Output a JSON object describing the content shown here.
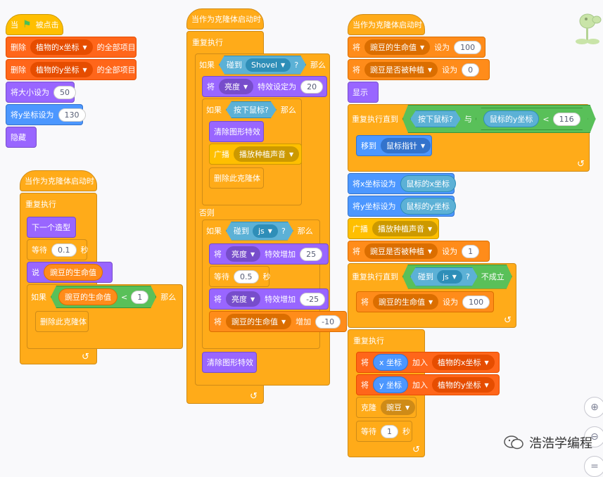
{
  "script1": {
    "hat_when": "当",
    "hat_clicked": "被点击",
    "del1_label": "删除",
    "del1_list": "植物的x坐标",
    "del1_suffix": "的全部项目",
    "del2_label": "删除",
    "del2_list": "植物的y坐标",
    "del2_suffix": "的全部项目",
    "size_label": "将大小设为",
    "size_value": "50",
    "sety_label": "将y坐标设为",
    "sety_value": "130",
    "hide_label": "隐藏"
  },
  "script2": {
    "hat": "当作为克隆体启动时",
    "forever": "重复执行",
    "next_costume": "下一个造型",
    "wait_label": "等待",
    "wait_value": "0.1",
    "wait_unit": "秒",
    "say_label": "说",
    "say_var": "豌豆的生命值",
    "if_label": "如果",
    "if_var": "豌豆的生命值",
    "if_op": "<",
    "if_value": "1",
    "if_then": "那么",
    "delete_clone": "删除此克隆体"
  },
  "script3": {
    "hat": "当作为克隆体启动时",
    "forever": "重复执行",
    "if_label": "如果",
    "touch_label": "碰到",
    "touch_target": "Shovel",
    "question": "?",
    "then": "那么",
    "set_label": "将",
    "effect": "亮度",
    "effect_set": "特效设定为",
    "effect_value": "20",
    "if2_label": "如果",
    "mouse_down": "按下鼠标?",
    "then2": "那么",
    "clear_effects": "清除图形特效",
    "broadcast_label": "广播",
    "broadcast_msg": "播放种植声音",
    "delete_clone": "删除此克隆体",
    "else_label": "否则",
    "if3_label": "如果",
    "touch2_label": "碰到",
    "touch2_target": "js",
    "question2": "?",
    "then3": "那么",
    "change_label": "将",
    "change_effect": "亮度",
    "change_word": "特效增加",
    "change_value": "25",
    "wait_label": "等待",
    "wait_value": "0.5",
    "wait_unit": "秒",
    "change2_label": "将",
    "change2_effect": "亮度",
    "change2_word": "特效增加",
    "change2_value": "-25",
    "var_change_label": "将",
    "var_change_var": "豌豆的生命值",
    "var_change_word": "增加",
    "var_change_value": "-10",
    "clear_effects2": "清除图形特效"
  },
  "script4": {
    "hat": "当作为克隆体启动时",
    "set1_label": "将",
    "set1_var": "豌豆的生命值",
    "set1_word": "设为",
    "set1_value": "100",
    "set2_label": "将",
    "set2_var": "豌豆是否被种植",
    "set2_word": "设为",
    "set2_value": "0",
    "show_label": "显示",
    "until_label": "重复执行直到",
    "mouse_down": "按下鼠标?",
    "and_word": "与",
    "mouse_y": "鼠标的y坐标",
    "lt_op": "<",
    "lt_value": "116",
    "goto_label": "移到",
    "goto_target": "鼠标指针",
    "setx_label": "将x坐标设为",
    "setx_value": "鼠标的x坐标",
    "sety_label": "将y坐标设为",
    "sety_value": "鼠标的y坐标",
    "broadcast_label": "广播",
    "broadcast_msg": "播放种植声音",
    "set3_label": "将",
    "set3_var": "豌豆是否被种植",
    "set3_word": "设为",
    "set3_value": "1",
    "until2_label": "重复执行直到",
    "touch_label": "碰到",
    "touch_target": "js",
    "question": "?",
    "not_word": "不成立",
    "set4_label": "将",
    "set4_var": "豌豆的生命值",
    "set4_word": "设为",
    "set4_value": "100",
    "forever": "重复执行",
    "add1_label": "将",
    "add1_rep": "x 坐标",
    "add1_word": "加入",
    "add1_list": "植物的x坐标",
    "add2_label": "将",
    "add2_rep": "y 坐标",
    "add2_word": "加入",
    "add2_list": "植物的y坐标",
    "clone_label": "克隆",
    "clone_target": "豌豆",
    "wait_label": "等待",
    "wait_value": "1",
    "wait_unit": "秒"
  },
  "zoom": {
    "zoom_in": "+",
    "zoom_out": "−",
    "reset": "="
  },
  "watermark": "浩浩学编程"
}
